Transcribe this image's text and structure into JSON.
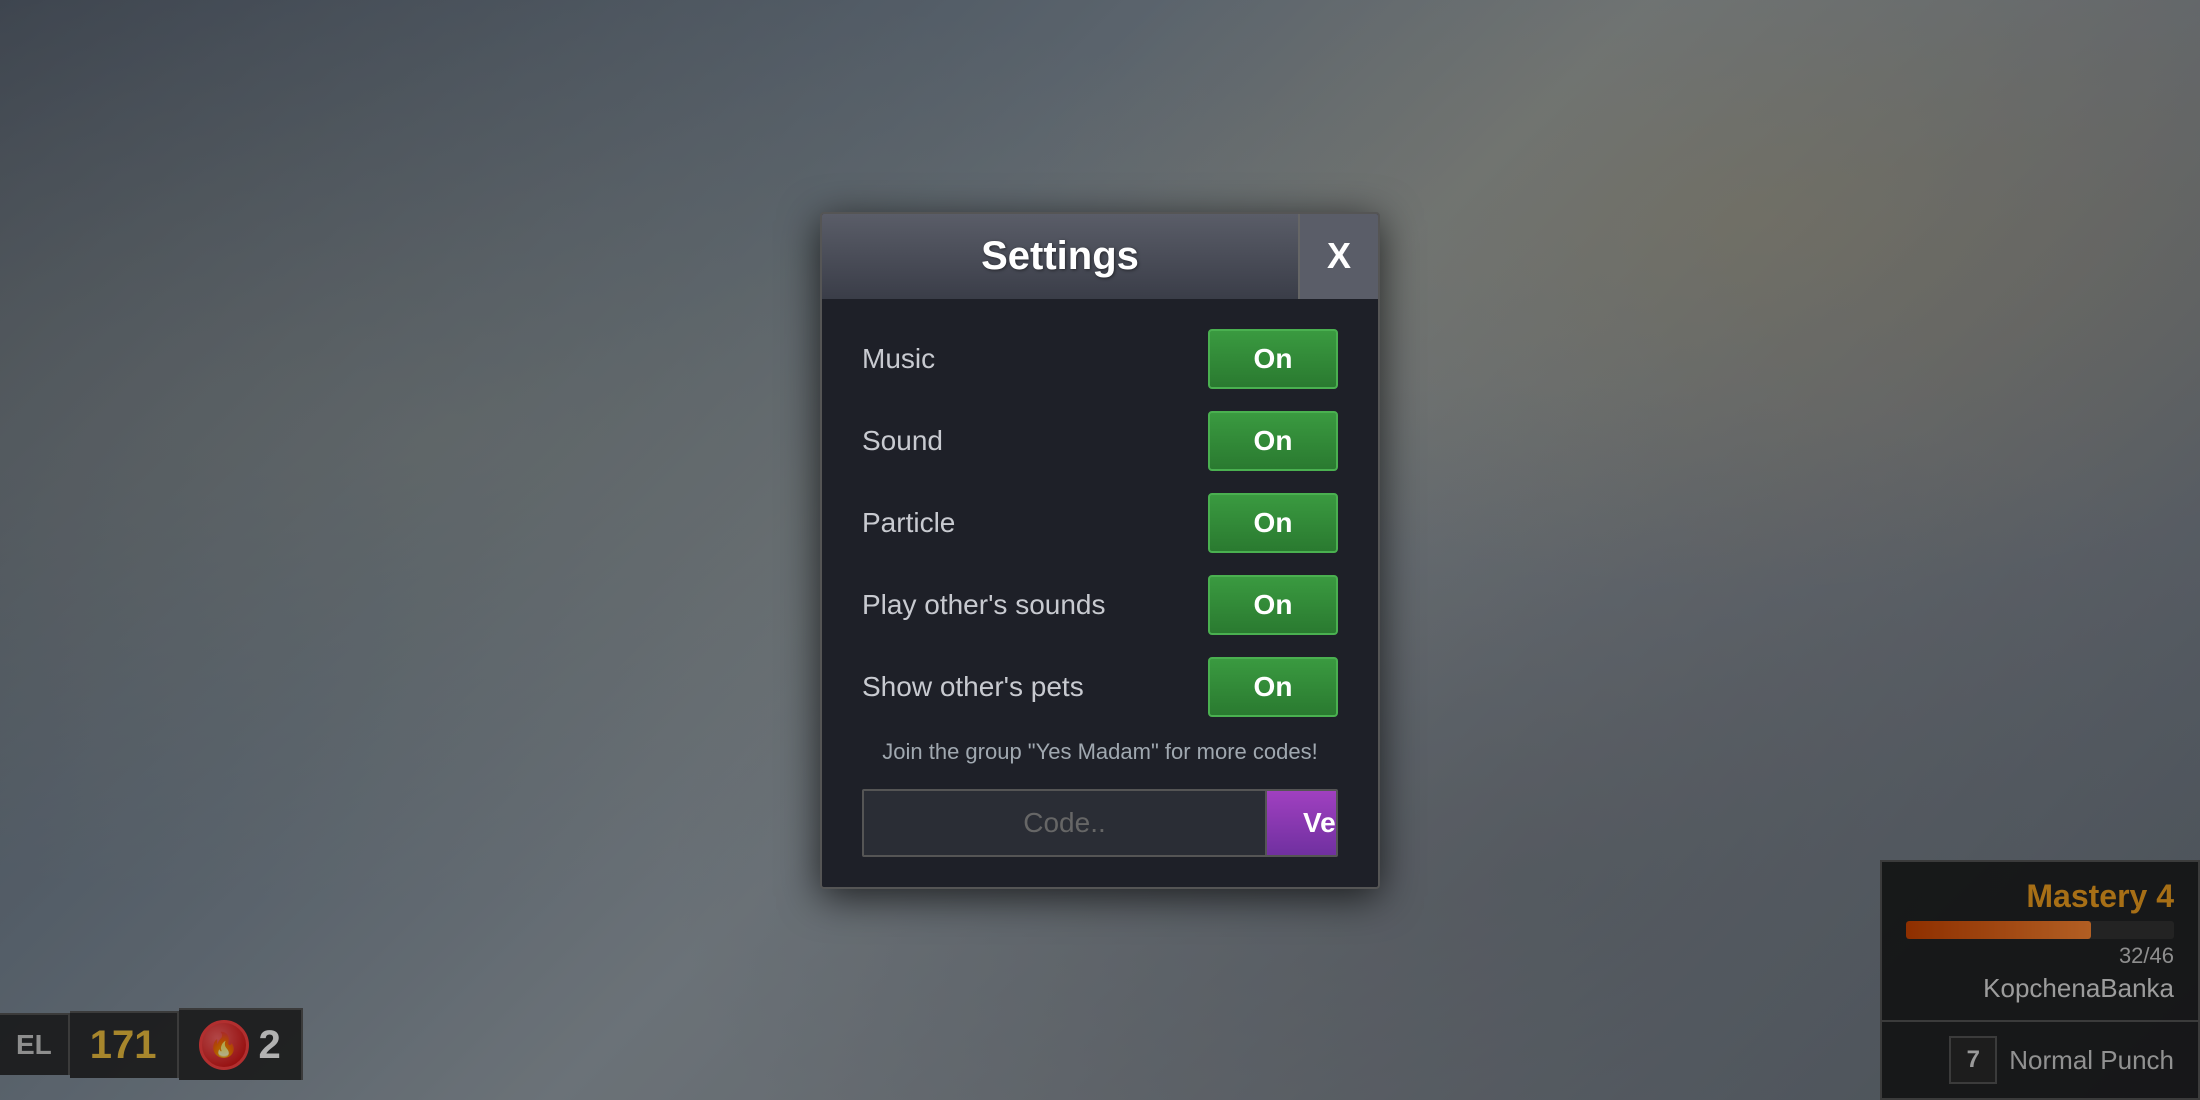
{
  "background": {
    "color": "#6b7a8a"
  },
  "hud": {
    "level_label": "EL",
    "coins": "171",
    "gems": "2",
    "mastery": {
      "title": "Mastery 4",
      "progress_current": 32,
      "progress_max": 46,
      "progress_text": "32/46",
      "progress_percent": 69,
      "player_name": "KopchenaBanka"
    },
    "skill": {
      "number": "7",
      "name": "Normal Punch"
    }
  },
  "settings": {
    "title": "Settings",
    "close_label": "X",
    "rows": [
      {
        "label": "Music",
        "value": "On"
      },
      {
        "label": "Sound",
        "value": "On"
      },
      {
        "label": "Particle",
        "value": "On"
      },
      {
        "label": "Play other's sounds",
        "value": "On"
      },
      {
        "label": "Show other's pets",
        "value": "On"
      }
    ],
    "promo_text": "Join the group \"Yes Madam\" for more codes!",
    "code_placeholder": "Code..",
    "verify_label": "Verify"
  }
}
